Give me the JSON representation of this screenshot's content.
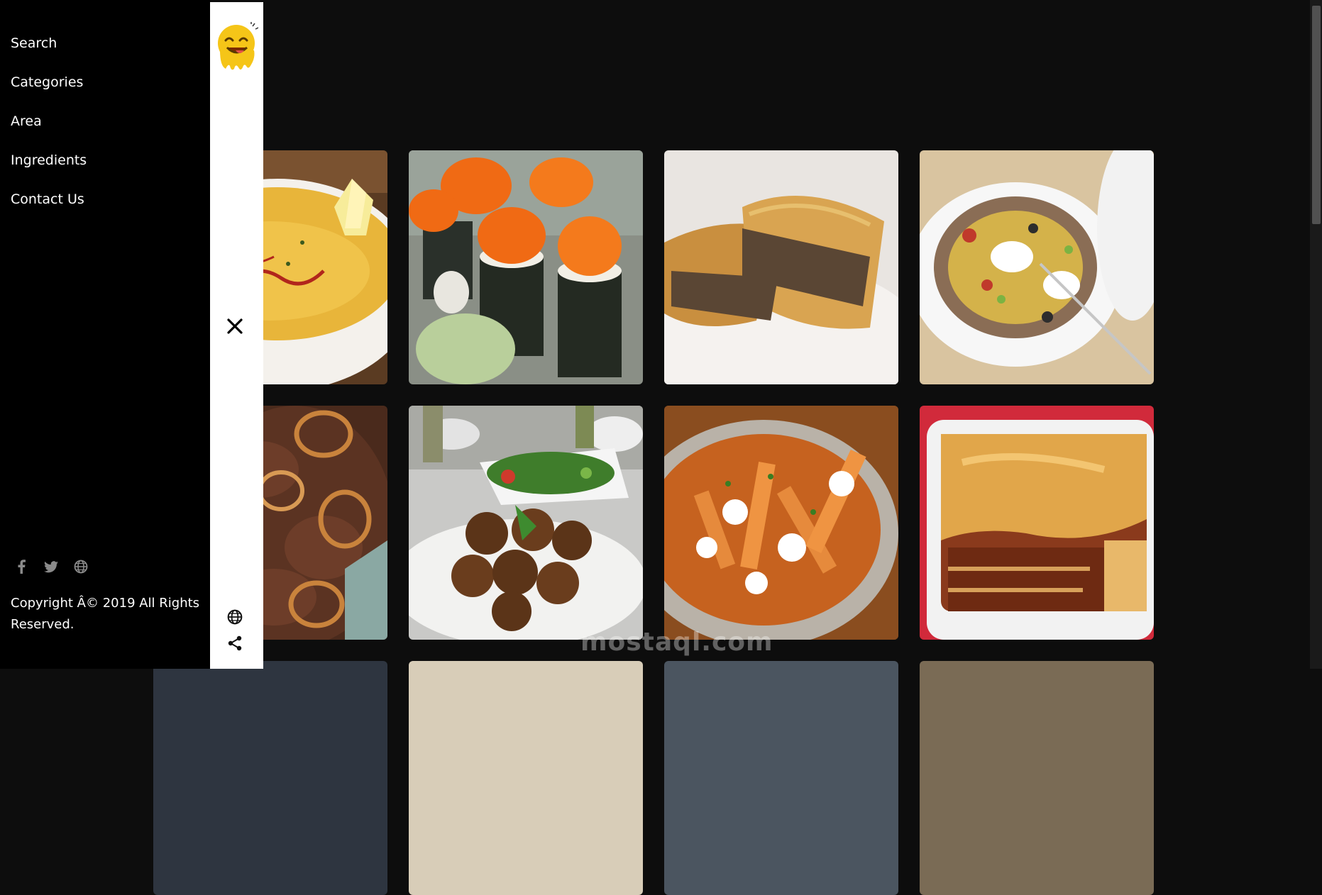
{
  "nav": {
    "items": [
      {
        "label": "Search"
      },
      {
        "label": "Categories"
      },
      {
        "label": "Area"
      },
      {
        "label": "Ingredients"
      },
      {
        "label": "Contact Us"
      }
    ]
  },
  "social": {
    "icons": [
      "facebook-icon",
      "twitter-icon",
      "globe-icon"
    ]
  },
  "footer": {
    "copyright": "Copyright Â© 2019 All Rights Reserved."
  },
  "strip": {
    "logo_icon": "smiley-logo",
    "close_icon": "close-icon",
    "bottom_icons": [
      "globe-icon",
      "share-icon"
    ]
  },
  "meals": [
    {
      "name": "lentil-soup"
    },
    {
      "name": "sushi"
    },
    {
      "name": "burek"
    },
    {
      "name": "stuffed-potato"
    },
    {
      "name": "beef-liver-onions"
    },
    {
      "name": "falafel"
    },
    {
      "name": "poutine"
    },
    {
      "name": "lasagne"
    },
    {
      "name": "meal-9"
    },
    {
      "name": "meal-10"
    },
    {
      "name": "meal-11"
    },
    {
      "name": "meal-12"
    }
  ],
  "watermark": "mostaql.com",
  "colors": {
    "page_bg": "#0d0d0d",
    "menu_bg": "#000000",
    "strip_bg": "#ffffff",
    "logo_yellow": "#f5c518"
  }
}
